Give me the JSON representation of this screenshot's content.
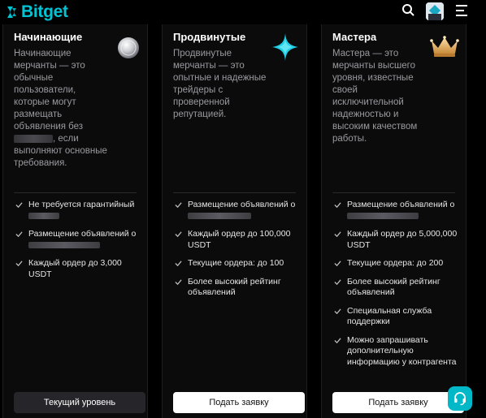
{
  "header": {
    "logo_text": "Bitget",
    "icons": [
      "bitget-logo-icon",
      "search-icon",
      "avatar",
      "menu-icon"
    ]
  },
  "colors": {
    "brand": "#00c4d4",
    "background": "#000000",
    "card": "#0b0b0c"
  },
  "cards": [
    {
      "title": "Начинающие",
      "badge_icon": "silver-coin-icon",
      "desc_a": "Начинающие мерчанты — это обычные пользователи, которые могут размещать объявления без",
      "desc_b": ", если выполняют основные требования.",
      "features": [
        {
          "text": "Не требуется гарантийный"
        },
        {
          "text": "Размещение объявлений о"
        },
        {
          "text": "Каждый ордер до 3,000 USDT"
        }
      ],
      "button": "Текущий уровень"
    },
    {
      "title": "Продвинутые",
      "badge_icon": "star-icon",
      "desc": "Продвинутые мерчанты — это опытные и надежные трейдеры с проверенной репутацией.",
      "features": [
        {
          "text": "Размещение объявлений о"
        },
        {
          "text": "Каждый ордер до 100,000 USDT"
        },
        {
          "text": "Текущие ордера: до 100"
        },
        {
          "text": "Более высокий рейтинг объявлений"
        }
      ],
      "button": "Подать заявку"
    },
    {
      "title": "Мастера",
      "badge_icon": "crown-icon",
      "desc": "Мастера — это мерчанты высшего уровня, известные своей исключительной надежностью и высоким качеством работы.",
      "features": [
        {
          "text": "Размещение объявлений о"
        },
        {
          "text": "Каждый ордер до 5,000,000 USDT"
        },
        {
          "text": "Текущие ордера: до 200"
        },
        {
          "text": "Более высокий рейтинг объявлений"
        },
        {
          "text": "Специальная служба поддержки"
        },
        {
          "text": "Можно запрашивать дополнительную информацию у контрагента"
        }
      ],
      "button": "Подать заявку"
    }
  ],
  "support_icon": "headset-icon"
}
